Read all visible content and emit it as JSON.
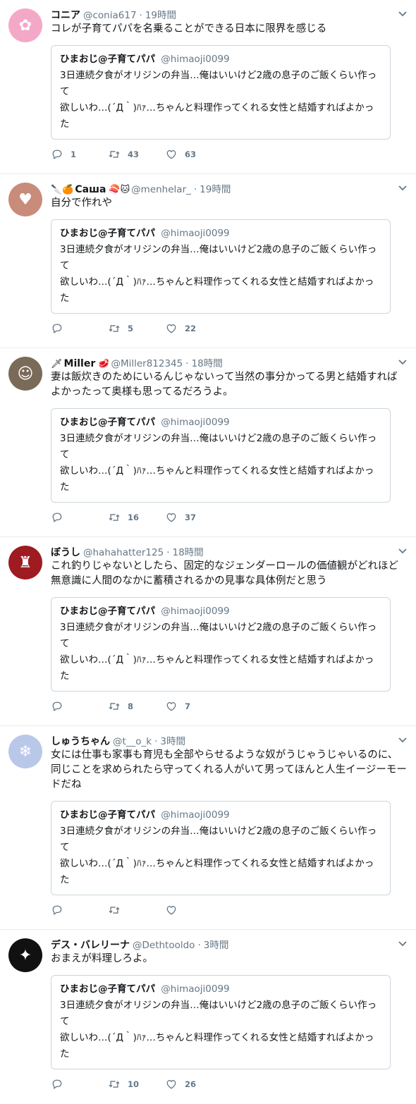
{
  "quote": {
    "name": "ひまおじ@子育てパパ",
    "handle": "@himaoji0099",
    "line1": "3日連続夕食がオリジンの弁当…俺はいいけど2歳の息子のご飯くらい作って",
    "line2": "欲しいわ…(´Д｀)ﾊｧ…ちゃんと料理作ってくれる女性と結婚すればよかった"
  },
  "tweets": [
    {
      "name": "コニア",
      "handle": "@conia617",
      "time": "19時間",
      "text": "コレが子育てパパを名乗ることができる日本に限界を感じる",
      "replies": "1",
      "retweets": "43",
      "likes": "63",
      "avatar_color": "#f4a8c8",
      "avatar_glyph": "✿"
    },
    {
      "name": "Саша",
      "name_prefix": "🔪🍊",
      "name_suffix": "🍣🐱",
      "handle": "@menhelar_",
      "time": "19時間",
      "text": "自分で作れや",
      "replies": "",
      "retweets": "5",
      "likes": "22",
      "avatar_color": "#c98b7a",
      "avatar_glyph": "♥"
    },
    {
      "name": "Miller",
      "name_prefix": "🗡",
      "name_suffix": "🥩",
      "handle": "@Miller812345",
      "time": "18時間",
      "text": "妻は飯炊きのためにいるんじゃないって当然の事分かってる男と結婚すればよかったって奥様も思ってるだろうよ。",
      "replies": "",
      "retweets": "16",
      "likes": "37",
      "avatar_color": "#7a6a58",
      "avatar_glyph": "☺"
    },
    {
      "name": "ぼうし",
      "handle": "@hahahatter125",
      "time": "18時間",
      "text": "これ釣りじゃないとしたら、固定的なジェンダーロールの価値観がどれほど無意識に人間のなかに蓄積されるかの見事な具体例だと思う",
      "replies": "",
      "retweets": "8",
      "likes": "7",
      "avatar_color": "#9e1b22",
      "avatar_glyph": "♜"
    },
    {
      "name": "しゅうちゃん",
      "handle": "@t__o_k",
      "time": "3時間",
      "text": "女には仕事も家事も育児も全部やらせるような奴がうじゃうじゃいるのに、同じことを求められたら守ってくれる人がいて男ってほんと人生イージーモードだね",
      "replies": "",
      "retweets": "",
      "likes": "",
      "avatar_color": "#b9c8e8",
      "avatar_glyph": "❄"
    },
    {
      "name": "デス・バレリーナ",
      "handle": "@Dethtooldo",
      "time": "3時間",
      "text": "おまえが料理しろよ。",
      "replies": "",
      "retweets": "10",
      "likes": "26",
      "avatar_color": "#111111",
      "avatar_glyph": "✦"
    }
  ]
}
